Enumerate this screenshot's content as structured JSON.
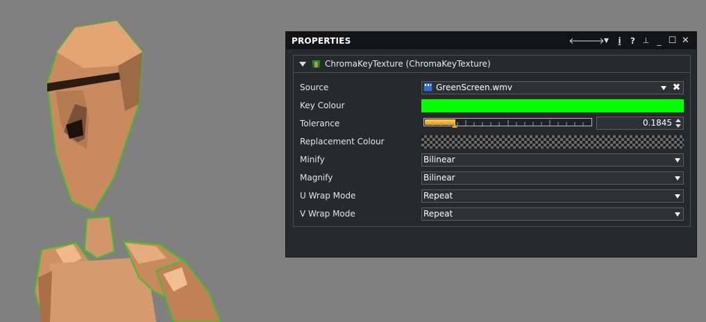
{
  "viewport": {
    "background_color": "#808080",
    "figure_description_icon": "wooden-mannequin-figure"
  },
  "panel": {
    "title": "PROPERTIES",
    "toolbar_icons": [
      "back-arrow-icon",
      "forward-arrow-icon",
      "dropdown-triangle-icon",
      "info-icon",
      "help-icon",
      "pin-icon",
      "minimize-icon",
      "maximize-icon",
      "close-icon"
    ],
    "toolbar_glyphs": {
      "back": "🡐",
      "forward": "🡒",
      "menu": "▼",
      "info": "i",
      "help": "?",
      "pin": "⊥",
      "minimize": "_",
      "maximize": "☐",
      "close": "✕"
    },
    "component": {
      "title": "ChromaKeyTexture (ChromaKeyTexture)",
      "properties": {
        "source": {
          "label": "Source",
          "value": "GreenScreen.wmv",
          "clear_glyph": "✖"
        },
        "key_colour": {
          "label": "Key Colour",
          "color": "#00ff00"
        },
        "tolerance": {
          "label": "Tolerance",
          "value": "0.1845",
          "fraction": 0.1845
        },
        "replacement_colour": {
          "label": "Replacement Colour"
        },
        "minify": {
          "label": "Minify",
          "value": "Bilinear"
        },
        "magnify": {
          "label": "Magnify",
          "value": "Bilinear"
        },
        "u_wrap_mode": {
          "label": "U Wrap Mode",
          "value": "Repeat"
        },
        "v_wrap_mode": {
          "label": "V Wrap Mode",
          "value": "Repeat"
        }
      }
    }
  }
}
